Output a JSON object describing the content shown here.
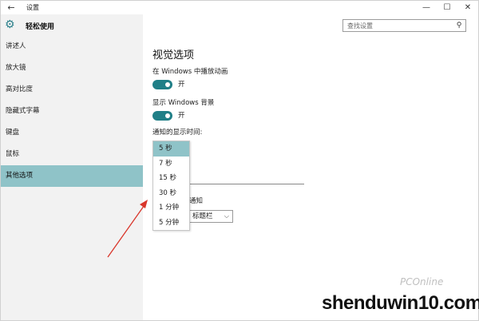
{
  "window": {
    "title": "设置",
    "back_glyph": "←",
    "minimize_glyph": "—",
    "maximize_glyph": "☐",
    "close_glyph": "✕"
  },
  "sidebar": {
    "brand_label": "轻松使用",
    "items": [
      {
        "label": "讲述人"
      },
      {
        "label": "放大镜"
      },
      {
        "label": "高对比度"
      },
      {
        "label": "隐藏式字幕"
      },
      {
        "label": "键盘"
      },
      {
        "label": "鼠标"
      },
      {
        "label": "其他选项"
      }
    ]
  },
  "search": {
    "placeholder": "查找设置"
  },
  "main": {
    "title": "视觉选项",
    "animation": {
      "label": "在 Windows 中播放动画",
      "state": "开"
    },
    "background": {
      "label": "显示 Windows 背景",
      "state": "开"
    },
    "notify_label": "通知的显示时间:",
    "notify_partial": "通知",
    "taskbar_partial": "标题栏",
    "dropdown_options": [
      "5 秒",
      "7 秒",
      "15 秒",
      "30 秒",
      "1 分钟",
      "5 分钟"
    ],
    "selected_option": "5 秒"
  },
  "watermark": {
    "logo": "PCOnline",
    "text": "shenduwin10.com"
  },
  "colors": {
    "accent": "#207f87",
    "selection": "#8fc3c8",
    "annotation_arrow": "#d9362b"
  }
}
